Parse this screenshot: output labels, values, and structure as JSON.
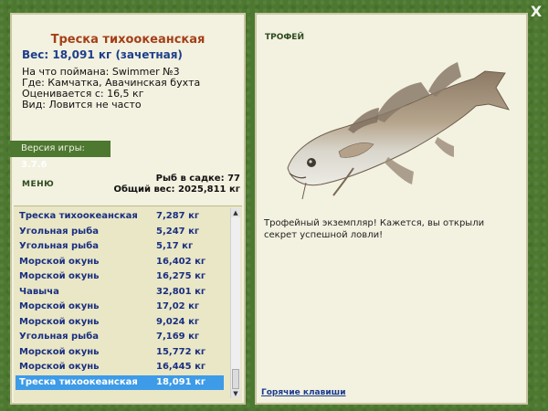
{
  "window": {
    "close_label": "X"
  },
  "fish": {
    "name": "Треска тихоокеанская",
    "weight": "Вес: 18,091 кг (зачетная)",
    "info": [
      "На что поймана: Swimmer №3",
      "Где: Камчатка, Авачинская бухта",
      "Оценивается с: 16,5 кг",
      "Вид: Ловится не часто"
    ]
  },
  "version": {
    "label": "Версия игры:",
    "value": "3.7.6"
  },
  "menu": {
    "label": "МЕНЮ"
  },
  "stats": {
    "count": "Рыб в садке: 77",
    "total": "Общий вес: 2025,811 кг"
  },
  "catch_list": [
    {
      "name": "Треска тихоокеанская",
      "weight": "7,287 кг"
    },
    {
      "name": "Угольная рыба",
      "weight": "5,247 кг"
    },
    {
      "name": "Угольная рыба",
      "weight": "5,17 кг"
    },
    {
      "name": "Морской окунь",
      "weight": "16,402 кг"
    },
    {
      "name": "Морской окунь",
      "weight": "16,275 кг"
    },
    {
      "name": "Чавыча",
      "weight": "32,801 кг"
    },
    {
      "name": "Морской окунь",
      "weight": "17,02 кг"
    },
    {
      "name": "Морской окунь",
      "weight": "9,024 кг"
    },
    {
      "name": "Угольная рыба",
      "weight": "7,169 кг"
    },
    {
      "name": "Морской окунь",
      "weight": "15,772 кг"
    },
    {
      "name": "Морской окунь",
      "weight": "16,445 кг"
    },
    {
      "name": "Треска тихоокеанская",
      "weight": "18,091 кг",
      "selected": true
    }
  ],
  "trophy": {
    "title": "ТРОФЕЙ",
    "text": "Трофейный экземпляр! Кажется, вы открыли секрет успешной ловли!",
    "hotkeys_label": "Горячие клавиши"
  },
  "colors": {
    "background": "#4c7830",
    "panel": "#f3f1e0",
    "fish_name": "#a43f17",
    "list_text": "#1a2f80",
    "selection": "#3d9be8"
  }
}
